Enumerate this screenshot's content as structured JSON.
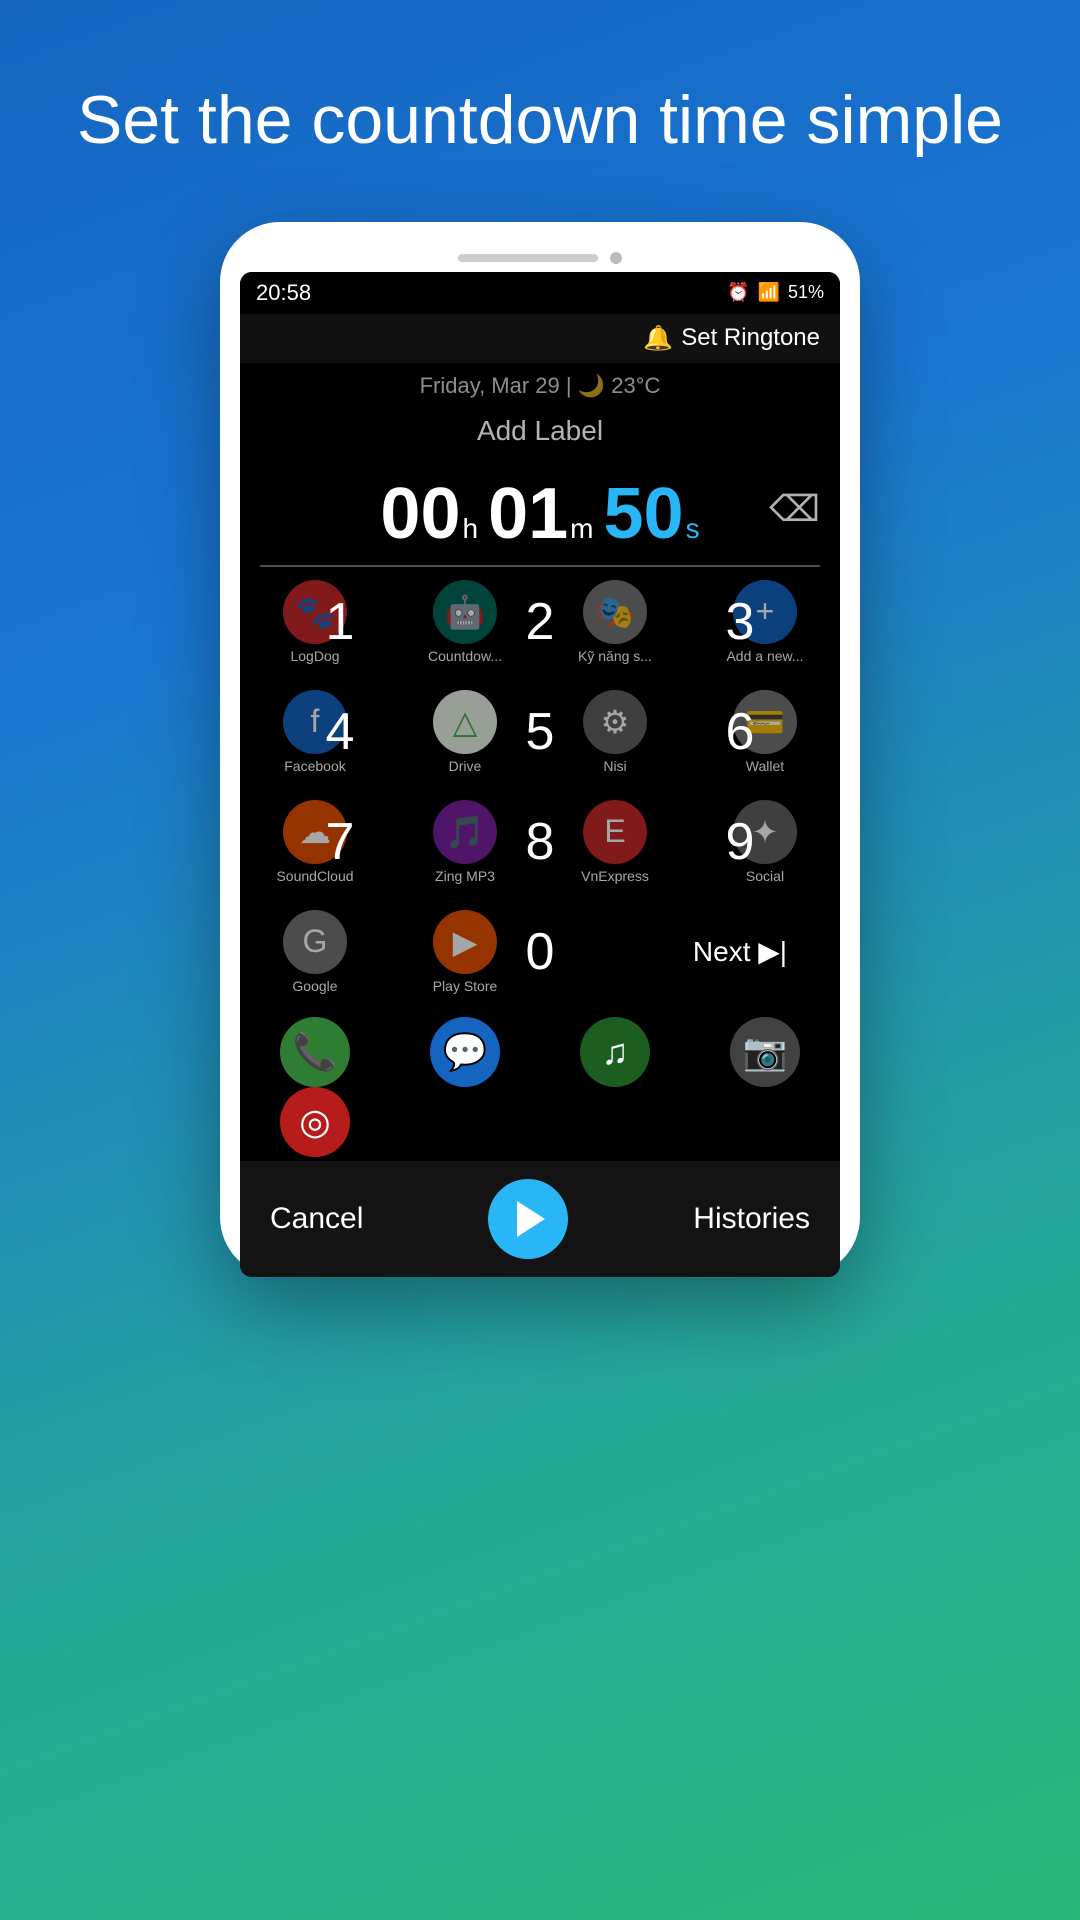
{
  "hero": {
    "title": "Set the countdown time simple"
  },
  "status_bar": {
    "time": "20:58",
    "battery": "51%",
    "alarm_icon": "⏰",
    "signal_icon": "📶",
    "battery_icon": "🔋"
  },
  "app_header": {
    "set_ringtone_label": "Set Ringtone",
    "bell_icon": "🔔"
  },
  "date_weather": {
    "text": "Friday, Mar 29 | 🌙 23°C"
  },
  "add_label": {
    "text": "Add Label"
  },
  "timer": {
    "hours": "00",
    "hours_unit": "h",
    "minutes": "01",
    "minutes_unit": "m",
    "seconds": "50",
    "seconds_unit": "s"
  },
  "numpad": {
    "buttons": [
      "1",
      "2",
      "3",
      "4",
      "5",
      "6",
      "7",
      "8",
      "9",
      "0"
    ],
    "next_label": "Next ▶|"
  },
  "bottom_bar": {
    "cancel_label": "Cancel",
    "histories_label": "Histories"
  },
  "app_icons": [
    {
      "label": "LogDog",
      "color": "#D32F2F",
      "icon": "🐾"
    },
    {
      "label": "Countdow...",
      "color": "#00897B",
      "icon": "🤖"
    },
    {
      "label": "Kỹ năng s...",
      "color": "#9E9E9E",
      "icon": "🎭"
    },
    {
      "label": "Add a new...",
      "color": "#1565C0",
      "icon": "+"
    },
    {
      "label": "Facebook",
      "color": "#1565C0",
      "icon": "f"
    },
    {
      "label": "Drive",
      "color": "#F5F5F5",
      "icon": "△"
    },
    {
      "label": "Nisi",
      "color": "#9E9E9E",
      "icon": "⚙"
    },
    {
      "label": "Wallet",
      "color": "#9E9E9E",
      "icon": "💳"
    },
    {
      "label": "SoundCloud",
      "color": "#E65100",
      "icon": "☁"
    },
    {
      "label": "Zing MP3",
      "color": "#9C27B0",
      "icon": "🎵"
    },
    {
      "label": "VnExpress",
      "color": "#E53935",
      "icon": "E"
    },
    {
      "label": "Social",
      "color": "#9E9E9E",
      "icon": "✦"
    },
    {
      "label": "Google",
      "color": "#9E9E9E",
      "icon": "G"
    },
    {
      "label": "Play Store",
      "color": "#E65100",
      "icon": "▶"
    }
  ],
  "dock_icons": [
    {
      "label": "Phone",
      "color": "#1B5E20",
      "icon": "📞"
    },
    {
      "label": "Messages",
      "color": "#1565C0",
      "icon": "💬"
    },
    {
      "label": "Spotify",
      "color": "#1B5E20",
      "icon": "♫"
    },
    {
      "label": "Camera",
      "color": "#424242",
      "icon": "📷"
    },
    {
      "label": "Chrome",
      "color": "#E53935",
      "icon": "◎"
    }
  ]
}
